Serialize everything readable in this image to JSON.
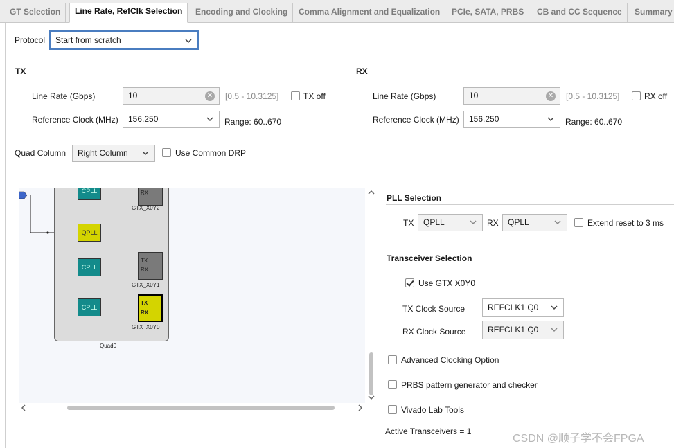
{
  "tabs": [
    "GT Selection",
    "Line Rate, RefClk Selection",
    "Encoding and Clocking",
    "Comma Alignment and Equalization",
    "PCIe, SATA, PRBS",
    "CB and CC Sequence",
    "Summary"
  ],
  "protocol": {
    "label": "Protocol",
    "value": "Start from scratch"
  },
  "tx": {
    "title": "TX",
    "line_rate_label": "Line Rate (Gbps)",
    "line_rate_value": "10",
    "line_rate_range": "[0.5 - 10.3125]",
    "off_label": "TX off",
    "ref_clock_label": "Reference Clock (MHz)",
    "ref_clock_value": "156.250",
    "ref_clock_range": "Range: 60..670"
  },
  "rx": {
    "title": "RX",
    "line_rate_label": "Line Rate (Gbps)",
    "line_rate_value": "10",
    "line_rate_range": "[0.5 - 10.3125]",
    "off_label": "RX off",
    "ref_clock_label": "Reference Clock (MHz)",
    "ref_clock_value": "156.250",
    "ref_clock_range": "Range: 60..670"
  },
  "quad_column": {
    "label": "Quad Column",
    "value": "Right Column",
    "common_drp_label": "Use Common DRP"
  },
  "diagram": {
    "cpll": "CPLL",
    "qpll": "QPLL",
    "tx": "TX",
    "rx": "RX",
    "gtx_y2": "GTX_X0Y2",
    "gtx_y1": "GTX_X0Y1",
    "gtx_y0": "GTX_X0Y0",
    "quad": "Quad0"
  },
  "pll_selection": {
    "title": "PLL Selection",
    "tx_label": "TX",
    "tx_value": "QPLL",
    "rx_label": "RX",
    "rx_value": "QPLL",
    "extend_reset_label": "Extend reset to 3 ms"
  },
  "transceiver_selection": {
    "title": "Transceiver Selection",
    "use_gtx_label": "Use GTX X0Y0",
    "use_gtx_checked": true,
    "tx_clock_label": "TX Clock Source",
    "tx_clock_value": "REFCLK1 Q0",
    "rx_clock_label": "RX Clock Source",
    "rx_clock_value": "REFCLK1 Q0"
  },
  "options": {
    "advanced_clocking": "Advanced Clocking Option",
    "prbs": "PRBS pattern generator and checker",
    "vivado_lab": "Vivado Lab Tools"
  },
  "active_transceivers": "Active Transceivers = 1",
  "watermark": "CSDN @顺子学不会FPGA",
  "colors": {
    "cpll": "#138b8b",
    "qpll": "#d4d400",
    "focus_border": "#4a7dc0"
  }
}
